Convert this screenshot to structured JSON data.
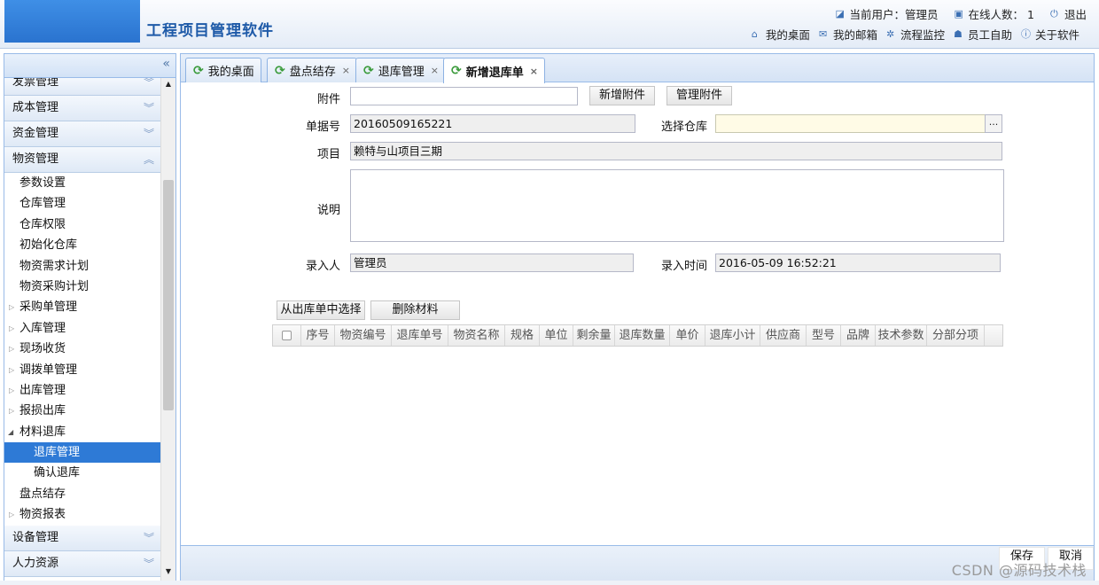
{
  "header": {
    "app_title": "工程项目管理软件",
    "current_user": "当前用户：管理员",
    "online_count": "在线人数： 1",
    "logout": "退出",
    "nav": [
      "我的桌面",
      "我的邮箱",
      "流程监控",
      "员工自助",
      "关于软件"
    ]
  },
  "sidebar": {
    "collapse_icon": "«",
    "partial_group": "发票管理",
    "groups_top": [
      "成本管理",
      "资金管理",
      "物资管理"
    ],
    "items": [
      {
        "label": "参数设置",
        "type": "plain"
      },
      {
        "label": "仓库管理",
        "type": "plain"
      },
      {
        "label": "仓库权限",
        "type": "plain"
      },
      {
        "label": "初始化仓库",
        "type": "plain"
      },
      {
        "label": "物资需求计划",
        "type": "plain"
      },
      {
        "label": "物资采购计划",
        "type": "plain"
      },
      {
        "label": "采购单管理",
        "type": "expand"
      },
      {
        "label": "入库管理",
        "type": "expand"
      },
      {
        "label": "现场收货",
        "type": "expand"
      },
      {
        "label": "调拨单管理",
        "type": "expand"
      },
      {
        "label": "出库管理",
        "type": "expand"
      },
      {
        "label": "报损出库",
        "type": "expand"
      },
      {
        "label": "材料退库",
        "type": "open"
      },
      {
        "label": "退库管理",
        "type": "sub-selected"
      },
      {
        "label": "确认退库",
        "type": "sub"
      },
      {
        "label": "盘点结存",
        "type": "plain"
      },
      {
        "label": "物资报表",
        "type": "expand"
      }
    ],
    "groups_bottom": [
      "设备管理",
      "人力资源"
    ]
  },
  "tabs": [
    {
      "label": "我的桌面",
      "closable": false
    },
    {
      "label": "盘点结存",
      "closable": true
    },
    {
      "label": "退库管理",
      "closable": true
    },
    {
      "label": "新增退库单",
      "closable": true,
      "active": true
    }
  ],
  "form": {
    "attachment_label": "附件",
    "attachment_value": "",
    "add_attachment": "新增附件",
    "manage_attachment": "管理附件",
    "doc_no_label": "单据号",
    "doc_no_value": "20160509165221",
    "warehouse_label": "选择仓库",
    "warehouse_value": "",
    "warehouse_picker": "...",
    "project_label": "项目",
    "project_value": "赖特与山项目三期",
    "note_label": "说明",
    "note_value": "",
    "entered_by_label": "录入人",
    "entered_by_value": "管理员",
    "entry_time_label": "录入时间",
    "entry_time_value": "2016-05-09 16:52:21"
  },
  "grid": {
    "select_from_outbound": "从出库单中选择",
    "delete_material": "删除材料",
    "columns": [
      "序号",
      "物资编号",
      "退库单号",
      "物资名称",
      "规格",
      "单位",
      "剩余量",
      "退库数量",
      "单价",
      "退库小计",
      "供应商",
      "型号",
      "品牌",
      "技术参数",
      "分部分项"
    ]
  },
  "footer": {
    "save": "保存",
    "cancel": "取消",
    "watermark": "CSDN @源码技术栈"
  }
}
